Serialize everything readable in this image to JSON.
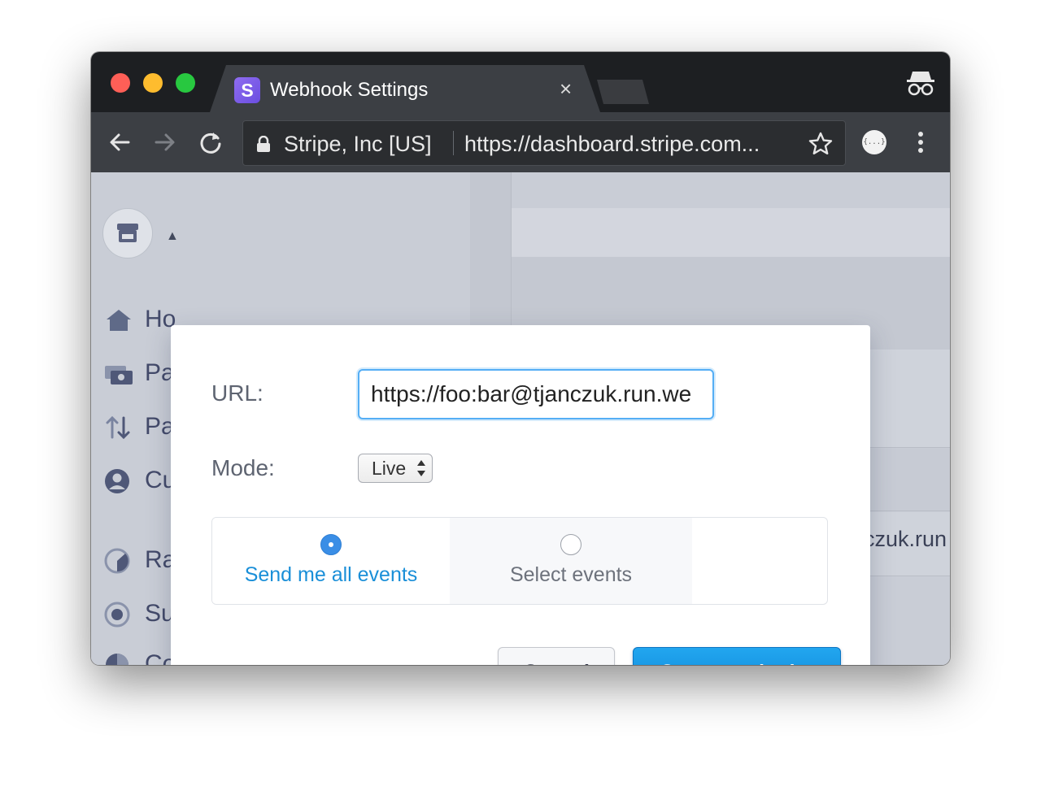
{
  "browser": {
    "tab": {
      "favicon_letter": "S",
      "title": "Webhook Settings",
      "close_glyph": "×"
    },
    "omnibox": {
      "site_identity": "Stripe, Inc [US]",
      "url_scheme": "https://",
      "url_rest": "dashboard.stripe.com..."
    },
    "extension_label": "{...}"
  },
  "sidebar": {
    "items": [
      {
        "label": "Ho",
        "icon": "home-icon"
      },
      {
        "label": "Pa",
        "icon": "payments-icon"
      },
      {
        "label": "Pa",
        "icon": "transfers-icon"
      },
      {
        "label": "Cu",
        "icon": "customers-icon"
      },
      {
        "label": "Ra",
        "icon": "radar-icon"
      },
      {
        "label": "Subscriptions",
        "icon": "subscriptions-icon"
      },
      {
        "label": "Connect",
        "icon": "connect-icon"
      }
    ]
  },
  "background": {
    "endpoint_fragment": "czuk.run"
  },
  "modal": {
    "url_label": "URL:",
    "url_value": "https://foo:bar@tjanczuk.run.we",
    "mode_label": "Mode:",
    "mode_value": "Live",
    "events": {
      "all_label": "Send me all events",
      "select_label": "Select events",
      "selected": "all"
    },
    "cancel_label": "Cancel",
    "create_label": "Create endpoint"
  },
  "colors": {
    "accent": "#1a8fd8",
    "primary_button": "#1b9ae8",
    "focus_ring": "#55aef5",
    "chrome_dark": "#1d1f22"
  }
}
